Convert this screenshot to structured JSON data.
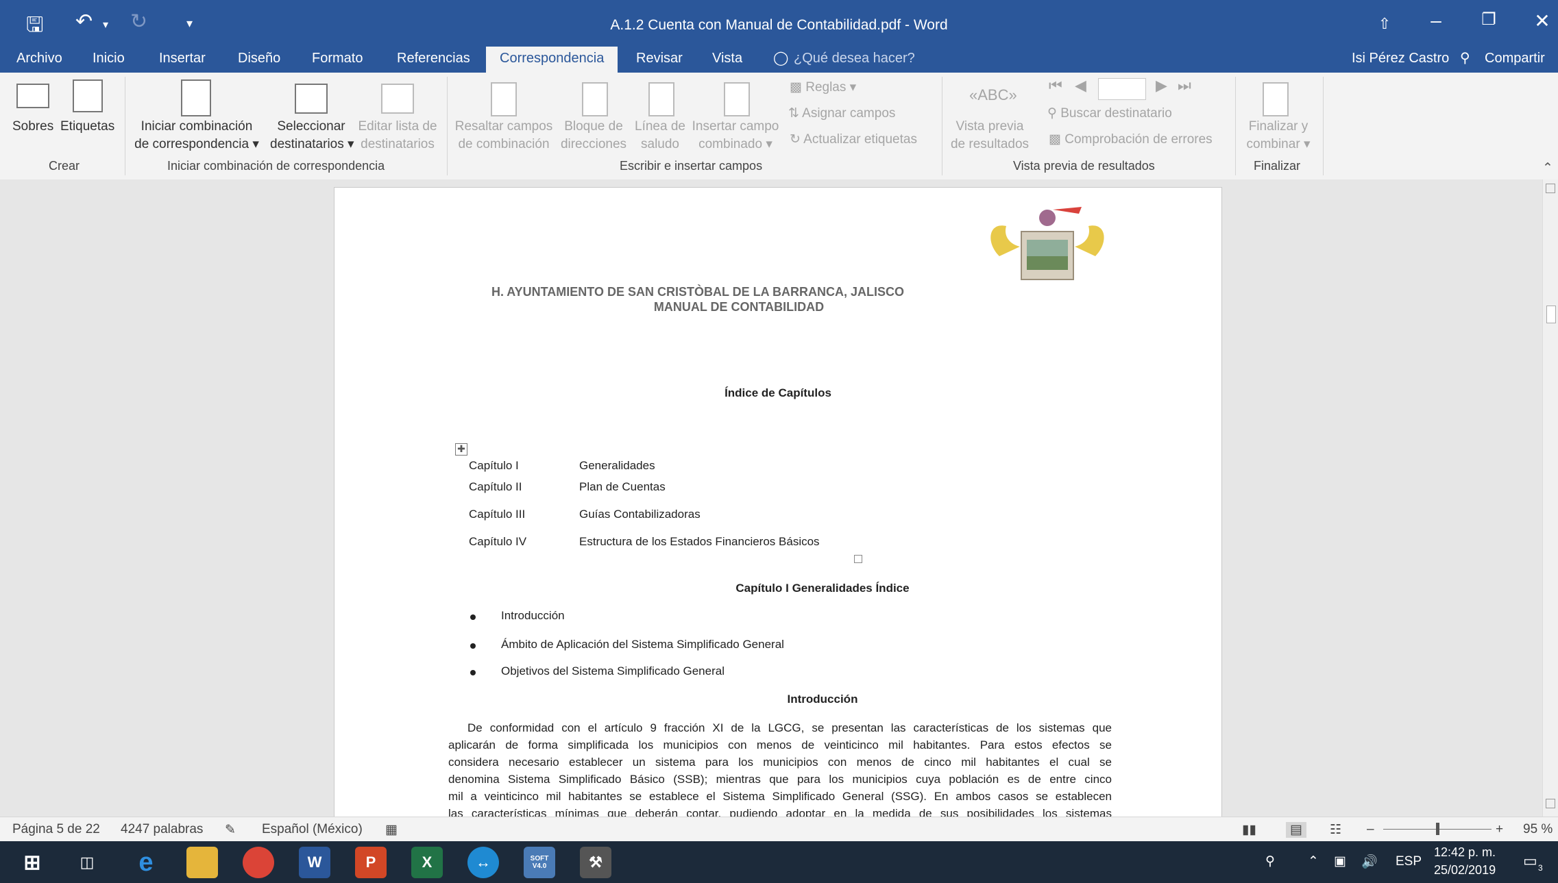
{
  "window": {
    "title": "A.1.2 Cuenta con Manual de Contabilidad.pdf - Word",
    "user": "Isi Pérez Castro",
    "share": "Compartir"
  },
  "tabs": [
    "Archivo",
    "Inicio",
    "Insertar",
    "Diseño",
    "Formato",
    "Referencias",
    "Correspondencia",
    "Revisar",
    "Vista"
  ],
  "tell_me": "¿Qué desea hacer?",
  "ribbon": {
    "crear": {
      "group": "Crear",
      "sobres": "Sobres",
      "etiquetas": "Etiquetas"
    },
    "iniciar": {
      "group": "Iniciar combinación de correspondencia",
      "iniciar_1": "Iniciar combinación",
      "iniciar_2": "de correspondencia",
      "seleccionar_1": "Seleccionar",
      "seleccionar_2": "destinatarios",
      "editar_1": "Editar lista de",
      "editar_2": "destinatarios"
    },
    "escribir": {
      "group": "Escribir e insertar campos",
      "resaltar_1": "Resaltar campos",
      "resaltar_2": "de combinación",
      "bloque_1": "Bloque de",
      "bloque_2": "direcciones",
      "linea_1": "Línea de",
      "linea_2": "saludo",
      "insertar_1": "Insertar campo",
      "insertar_2": "combinado",
      "reglas": "Reglas",
      "asignar": "Asignar campos",
      "actualizar": "Actualizar etiquetas"
    },
    "vista": {
      "group": "Vista previa de resultados",
      "vista_1": "Vista previa",
      "vista_2": "de resultados",
      "buscar": "Buscar destinatario",
      "comprobacion": "Comprobación de errores"
    },
    "finalizar": {
      "group": "Finalizar",
      "fin_1": "Finalizar y",
      "fin_2": "combinar"
    }
  },
  "document": {
    "header_1": "H. AYUNTAMIENTO DE SAN CRISTÒBAL DE LA BARRANCA, JALISCO",
    "header_2": "MANUAL DE CONTABILIDAD",
    "index_title": "Índice de Capítulos",
    "chapters": [
      {
        "num": "Capítulo I",
        "name": "Generalidades"
      },
      {
        "num": "Capítulo II",
        "name": "Plan de Cuentas"
      },
      {
        "num": "Capítulo III",
        "name": "Guías Contabilizadoras"
      },
      {
        "num": "Capítulo IV",
        "name": "Estructura de los Estados Financieros Básicos"
      }
    ],
    "chapter1_title": "Capítulo I Generalidades Índice",
    "bullets": [
      "Introducción",
      "Ámbito de Aplicación del Sistema Simplificado General",
      "Objetivos del Sistema Simplificado General"
    ],
    "intro_title": "Introducción",
    "intro_lines": [
      "De conformidad con el artículo 9 fracción XI de la LGCG, se presentan las características de los sistemas que",
      "aplicarán de forma simplificada los municipios con menos de veinticinco mil habitantes. Para estos efectos se",
      "considera necesario establecer un sistema para los municipios con menos de cinco mil habitantes el cual se",
      "denomina Sistema Simplificado Básico (SSB); mientras que para los municipios cuya población es de entre cinco",
      "mil a veinticinco mil habitantes se establece el Sistema Simplificado General (SSG). En ambos casos se establecen",
      "las características mínimas que deberán contar, pudiendo adoptar en la medida de sus posibilidades los sistemas"
    ]
  },
  "status": {
    "page": "Página 5 de 22",
    "words": "4247 palabras",
    "language": "Español (México)",
    "zoom": "95 %",
    "zoom_level": 0.5
  },
  "taskbar": {
    "lang": "ESP",
    "time": "12:42 p. m.",
    "date": "25/02/2019",
    "notif": "3",
    "word_icon": "W",
    "ppt_icon": "P",
    "excel_icon": "X",
    "soft_icon": "SOFT V4.0"
  }
}
